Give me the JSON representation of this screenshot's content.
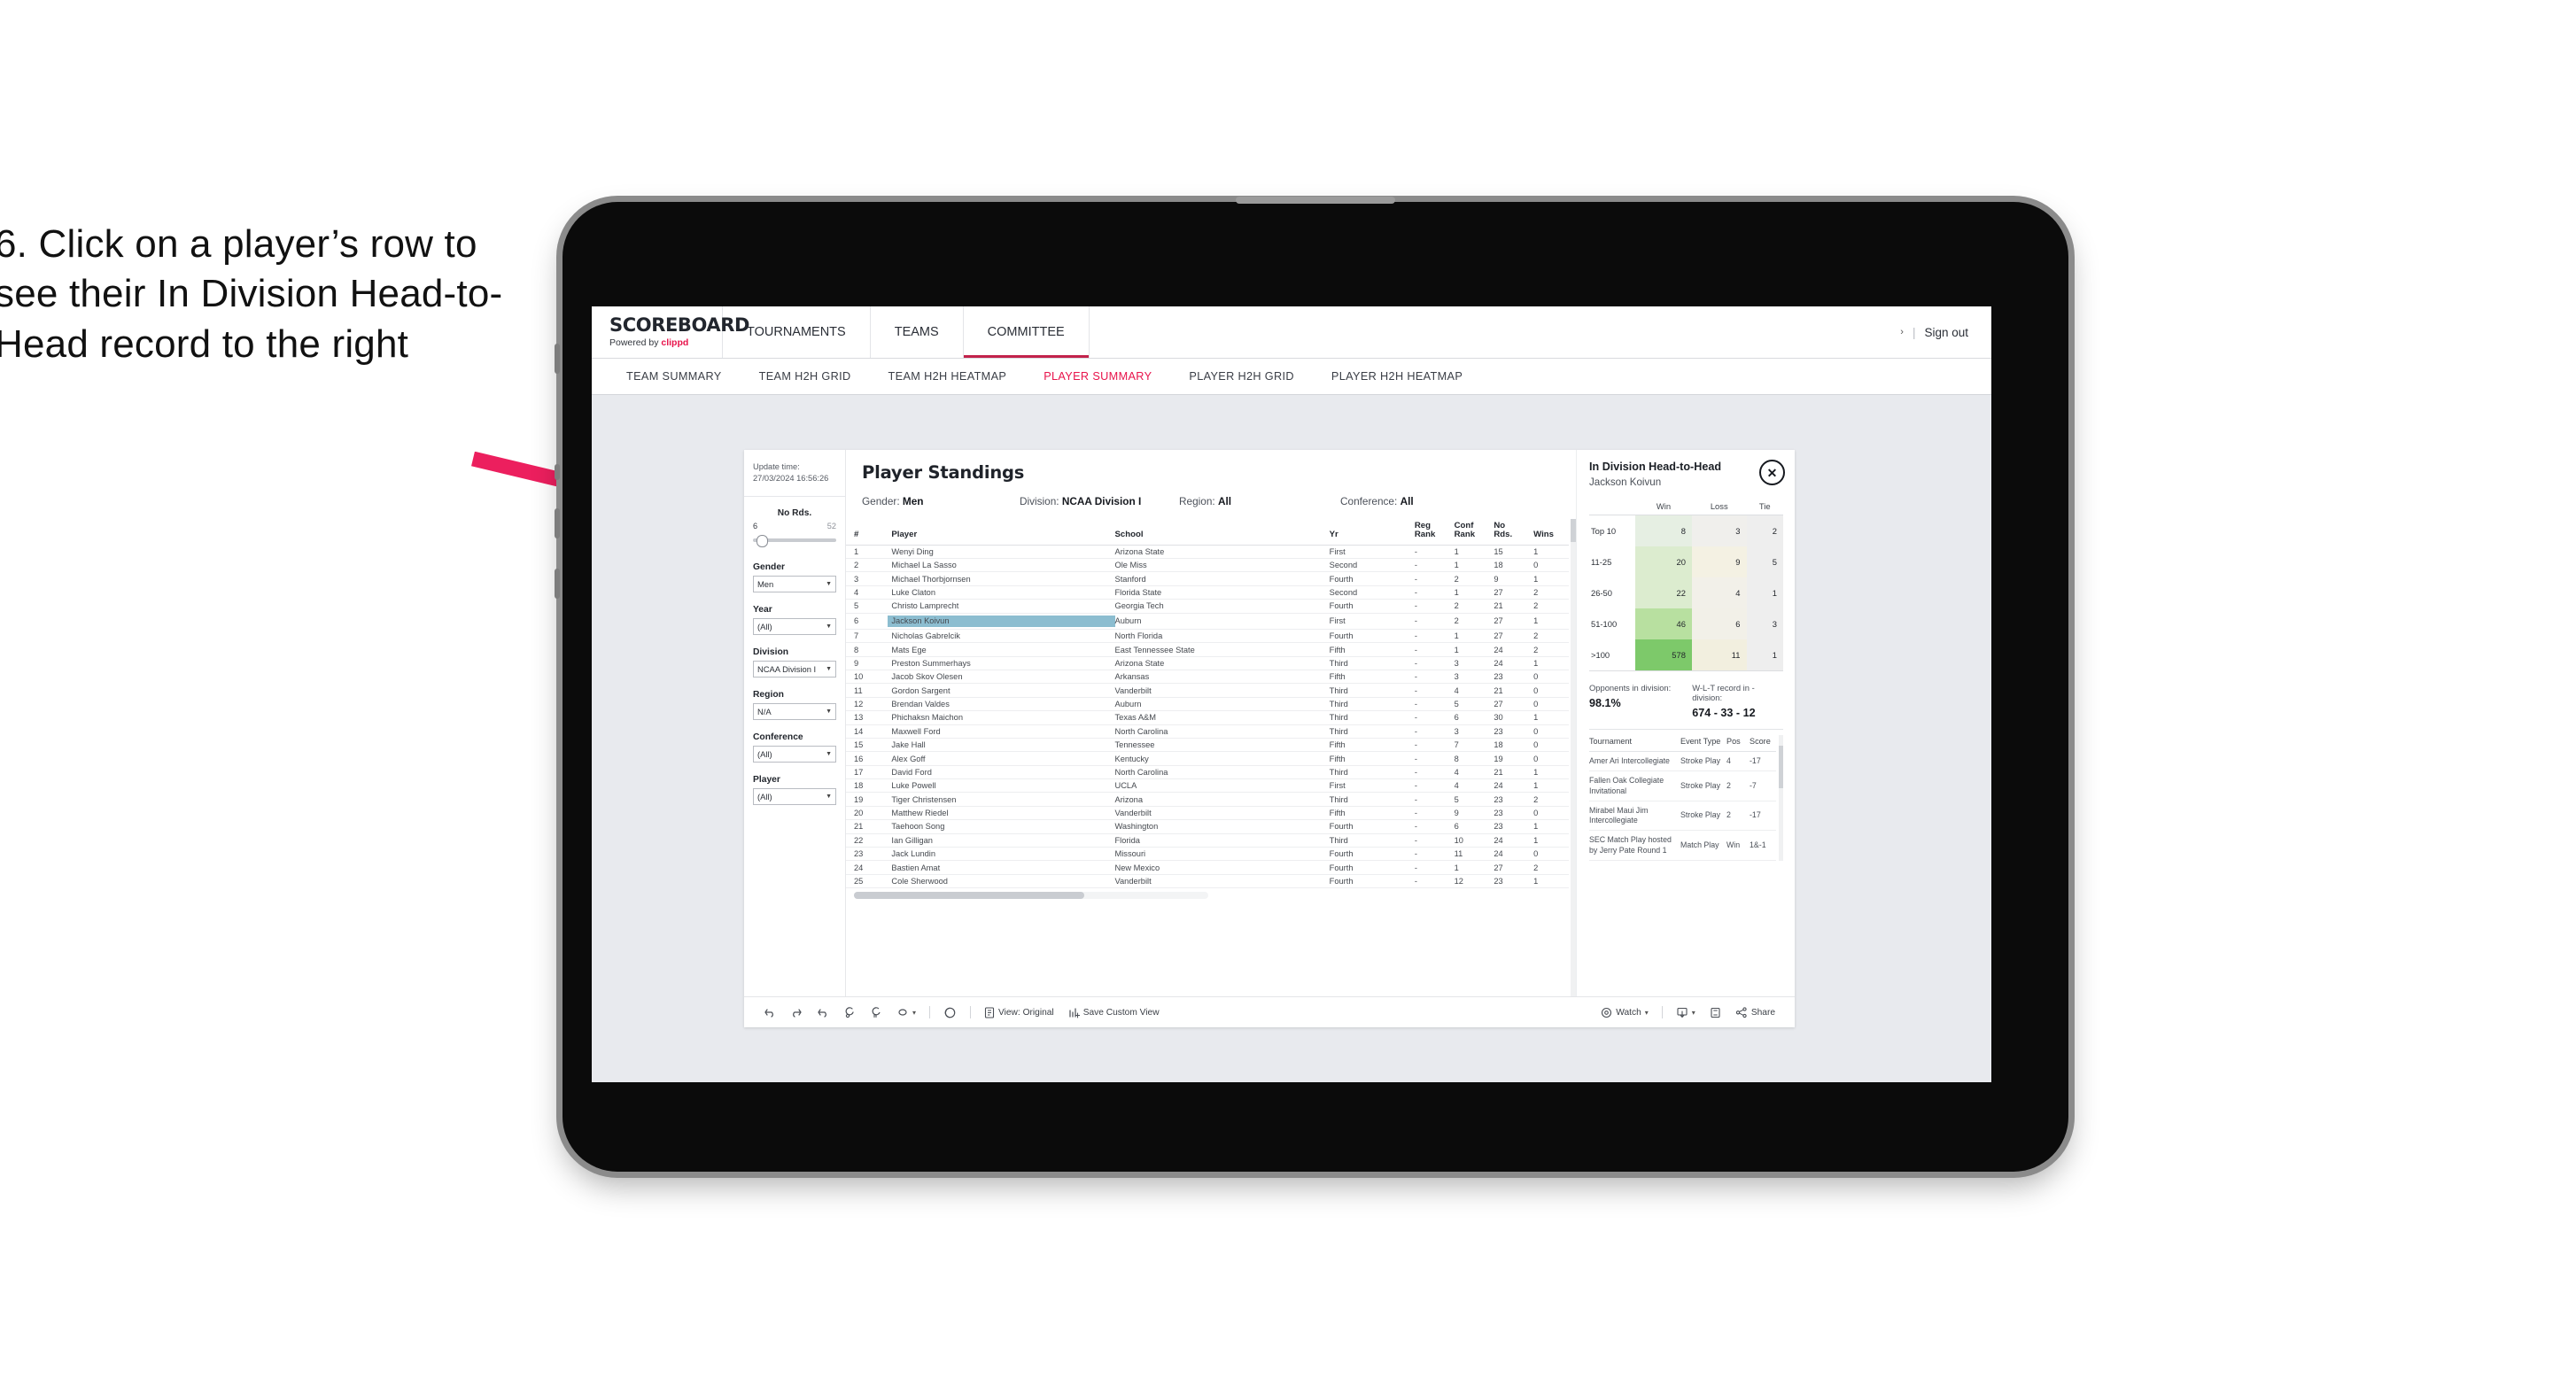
{
  "annotation": {
    "text": "6. Click on a player’s row to see their In Division Head-to-Head record to the right",
    "arrow_color": "#ec1f5e"
  },
  "app": {
    "logo_main": "SCOREBOARD",
    "logo_sub_prefix": "Powered by ",
    "logo_sub_brand": "clippd",
    "top_nav": [
      {
        "label": "TOURNAMENTS",
        "active": false
      },
      {
        "label": "TEAMS",
        "active": false
      },
      {
        "label": "COMMITTEE",
        "active": true
      }
    ],
    "header_right": {
      "caret": "›",
      "divider": "|",
      "sign_out": "Sign out"
    },
    "sub_nav": [
      {
        "label": "TEAM SUMMARY",
        "active": false
      },
      {
        "label": "TEAM H2H GRID",
        "active": false
      },
      {
        "label": "TEAM H2H HEATMAP",
        "active": false
      },
      {
        "label": "PLAYER SUMMARY",
        "active": true
      },
      {
        "label": "PLAYER H2H GRID",
        "active": false
      },
      {
        "label": "PLAYER H2H HEATMAP",
        "active": false
      }
    ],
    "accent_color": "#e8134b"
  },
  "filters": {
    "update_time_label": "Update time:",
    "update_time_value": "27/03/2024 16:56:26",
    "slider": {
      "title": "No Rds.",
      "min": "6",
      "max": "52",
      "value_pct": 4
    },
    "selects": [
      {
        "label": "Gender",
        "value": "Men"
      },
      {
        "label": "Year",
        "value": "(All)"
      },
      {
        "label": "Division",
        "value": "NCAA Division I"
      },
      {
        "label": "Region",
        "value": "N/A"
      },
      {
        "label": "Conference",
        "value": "(All)"
      },
      {
        "label": "Player",
        "value": "(All)"
      }
    ]
  },
  "standings": {
    "title": "Player Standings",
    "criteria": [
      {
        "label": "Gender:",
        "value": "Men"
      },
      {
        "label": "Division:",
        "value": "NCAA Division I"
      },
      {
        "label": "Region:",
        "value": "All"
      },
      {
        "label": "Conference:",
        "value": "All"
      }
    ],
    "columns": [
      "#",
      "Player",
      "School",
      "Yr",
      "Reg Rank",
      "Conf Rank",
      "No Rds.",
      "Wins"
    ],
    "rows": [
      {
        "num": "1",
        "player": "Wenyi Ding",
        "school": "Arizona State",
        "yr": "First",
        "reg": "-",
        "conf": "1",
        "rds": "15",
        "wins": "1",
        "selected": false
      },
      {
        "num": "2",
        "player": "Michael La Sasso",
        "school": "Ole Miss",
        "yr": "Second",
        "reg": "-",
        "conf": "1",
        "rds": "18",
        "wins": "0",
        "selected": false
      },
      {
        "num": "3",
        "player": "Michael Thorbjornsen",
        "school": "Stanford",
        "yr": "Fourth",
        "reg": "-",
        "conf": "2",
        "rds": "9",
        "wins": "1",
        "selected": false
      },
      {
        "num": "4",
        "player": "Luke Claton",
        "school": "Florida State",
        "yr": "Second",
        "reg": "-",
        "conf": "1",
        "rds": "27",
        "wins": "2",
        "selected": false
      },
      {
        "num": "5",
        "player": "Christo Lamprecht",
        "school": "Georgia Tech",
        "yr": "Fourth",
        "reg": "-",
        "conf": "2",
        "rds": "21",
        "wins": "2",
        "selected": false
      },
      {
        "num": "6",
        "player": "Jackson Koivun",
        "school": "Auburn",
        "yr": "First",
        "reg": "-",
        "conf": "2",
        "rds": "27",
        "wins": "1",
        "selected": true
      },
      {
        "num": "7",
        "player": "Nicholas Gabrelcik",
        "school": "North Florida",
        "yr": "Fourth",
        "reg": "-",
        "conf": "1",
        "rds": "27",
        "wins": "2",
        "selected": false
      },
      {
        "num": "8",
        "player": "Mats Ege",
        "school": "East Tennessee State",
        "yr": "Fifth",
        "reg": "-",
        "conf": "1",
        "rds": "24",
        "wins": "2",
        "selected": false
      },
      {
        "num": "9",
        "player": "Preston Summerhays",
        "school": "Arizona State",
        "yr": "Third",
        "reg": "-",
        "conf": "3",
        "rds": "24",
        "wins": "1",
        "selected": false
      },
      {
        "num": "10",
        "player": "Jacob Skov Olesen",
        "school": "Arkansas",
        "yr": "Fifth",
        "reg": "-",
        "conf": "3",
        "rds": "23",
        "wins": "0",
        "selected": false
      },
      {
        "num": "11",
        "player": "Gordon Sargent",
        "school": "Vanderbilt",
        "yr": "Third",
        "reg": "-",
        "conf": "4",
        "rds": "21",
        "wins": "0",
        "selected": false
      },
      {
        "num": "12",
        "player": "Brendan Valdes",
        "school": "Auburn",
        "yr": "Third",
        "reg": "-",
        "conf": "5",
        "rds": "27",
        "wins": "0",
        "selected": false
      },
      {
        "num": "13",
        "player": "Phichaksn Maichon",
        "school": "Texas A&M",
        "yr": "Third",
        "reg": "-",
        "conf": "6",
        "rds": "30",
        "wins": "1",
        "selected": false
      },
      {
        "num": "14",
        "player": "Maxwell Ford",
        "school": "North Carolina",
        "yr": "Third",
        "reg": "-",
        "conf": "3",
        "rds": "23",
        "wins": "0",
        "selected": false
      },
      {
        "num": "15",
        "player": "Jake Hall",
        "school": "Tennessee",
        "yr": "Fifth",
        "reg": "-",
        "conf": "7",
        "rds": "18",
        "wins": "0",
        "selected": false
      },
      {
        "num": "16",
        "player": "Alex Goff",
        "school": "Kentucky",
        "yr": "Fifth",
        "reg": "-",
        "conf": "8",
        "rds": "19",
        "wins": "0",
        "selected": false
      },
      {
        "num": "17",
        "player": "David Ford",
        "school": "North Carolina",
        "yr": "Third",
        "reg": "-",
        "conf": "4",
        "rds": "21",
        "wins": "1",
        "selected": false
      },
      {
        "num": "18",
        "player": "Luke Powell",
        "school": "UCLA",
        "yr": "First",
        "reg": "-",
        "conf": "4",
        "rds": "24",
        "wins": "1",
        "selected": false
      },
      {
        "num": "19",
        "player": "Tiger Christensen",
        "school": "Arizona",
        "yr": "Third",
        "reg": "-",
        "conf": "5",
        "rds": "23",
        "wins": "2",
        "selected": false
      },
      {
        "num": "20",
        "player": "Matthew Riedel",
        "school": "Vanderbilt",
        "yr": "Fifth",
        "reg": "-",
        "conf": "9",
        "rds": "23",
        "wins": "0",
        "selected": false
      },
      {
        "num": "21",
        "player": "Taehoon Song",
        "school": "Washington",
        "yr": "Fourth",
        "reg": "-",
        "conf": "6",
        "rds": "23",
        "wins": "1",
        "selected": false
      },
      {
        "num": "22",
        "player": "Ian Gilligan",
        "school": "Florida",
        "yr": "Third",
        "reg": "-",
        "conf": "10",
        "rds": "24",
        "wins": "1",
        "selected": false
      },
      {
        "num": "23",
        "player": "Jack Lundin",
        "school": "Missouri",
        "yr": "Fourth",
        "reg": "-",
        "conf": "11",
        "rds": "24",
        "wins": "0",
        "selected": false
      },
      {
        "num": "24",
        "player": "Bastien Amat",
        "school": "New Mexico",
        "yr": "Fourth",
        "reg": "-",
        "conf": "1",
        "rds": "27",
        "wins": "2",
        "selected": false
      },
      {
        "num": "25",
        "player": "Cole Sherwood",
        "school": "Vanderbilt",
        "yr": "Fourth",
        "reg": "-",
        "conf": "12",
        "rds": "23",
        "wins": "1",
        "selected": false
      }
    ]
  },
  "detail": {
    "title": "In Division Head-to-Head",
    "player": "Jackson Koivun",
    "close_label": "✕",
    "heatmap": {
      "col_headers": [
        "Win",
        "Loss",
        "Tie"
      ],
      "rows": [
        {
          "label": "Top 10",
          "win": "8",
          "loss": "3",
          "tie": "2",
          "win_color": "#e6efe3",
          "loss_color": "#f0efec",
          "tie_color": "#eeeeee"
        },
        {
          "label": "11-25",
          "win": "20",
          "loss": "9",
          "tie": "5",
          "win_color": "#dceccf",
          "loss_color": "#f4f1e3",
          "tie_color": "#eeeeee"
        },
        {
          "label": "26-50",
          "win": "22",
          "loss": "4",
          "tie": "1",
          "win_color": "#dceccf",
          "loss_color": "#f2f0e9",
          "tie_color": "#eeeeee"
        },
        {
          "label": "51-100",
          "win": "46",
          "loss": "6",
          "tie": "3",
          "win_color": "#b8e0a0",
          "loss_color": "#f2f0e8",
          "tie_color": "#eeeeee"
        },
        {
          "label": ">100",
          "win": "578",
          "loss": "11",
          "tie": "1",
          "win_color": "#7dc96a",
          "loss_color": "#f2efdf",
          "tie_color": "#eeeeee"
        }
      ]
    },
    "stats": [
      {
        "label": "Opponents in division:",
        "value": "98.1%"
      },
      {
        "label": "W-L-T record in -division:",
        "value": "674 - 33 - 12"
      }
    ],
    "tournaments": {
      "columns": [
        "Tournament",
        "Event Type",
        "Pos",
        "Score"
      ],
      "rows": [
        {
          "tournament": "Amer Ari Intercollegiate",
          "event": "Stroke Play",
          "pos": "4",
          "score": "-17"
        },
        {
          "tournament": "Fallen Oak Collegiate Invitational",
          "event": "Stroke Play",
          "pos": "2",
          "score": "-7"
        },
        {
          "tournament": "Mirabel Maui Jim Intercollegiate",
          "event": "Stroke Play",
          "pos": "2",
          "score": "-17"
        },
        {
          "tournament": "SEC Match Play hosted by Jerry Pate Round 1",
          "event": "Match Play",
          "pos": "Win",
          "score": "1&-1"
        }
      ]
    }
  },
  "toolbar": {
    "undo": "undo-icon",
    "redo": "redo-icon",
    "revert": "revert-icon",
    "refresh": "refresh-data-icon",
    "pause": "pause-auto-update-icon",
    "highlight": "highlight-icon",
    "highlight_caret": "▾",
    "fit": "fit-icon",
    "view_label": "View: Original",
    "save_label": "Save Custom View",
    "watch_label": "Watch",
    "watch_caret": "▾",
    "download_caret": "▾",
    "share_label": "Share"
  }
}
